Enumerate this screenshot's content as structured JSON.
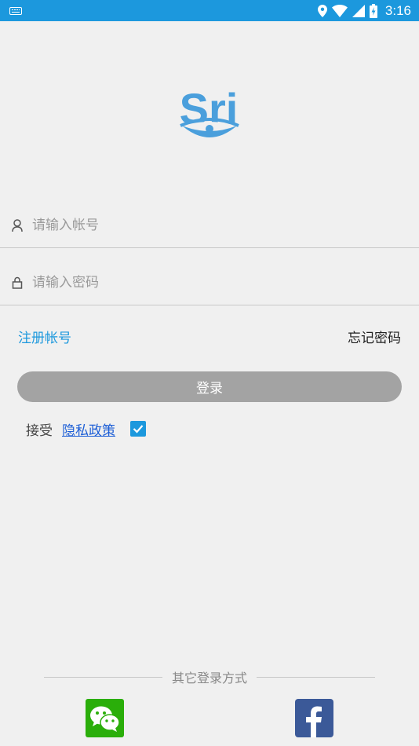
{
  "status_bar": {
    "time": "3:16"
  },
  "logo": {
    "text": "Sri",
    "color": "#4a9fdc"
  },
  "account": {
    "placeholder": "请输入帐号",
    "value": ""
  },
  "password": {
    "placeholder": "请输入密码",
    "value": ""
  },
  "links": {
    "register": "注册帐号",
    "forgot": "忘记密码"
  },
  "login": {
    "label": "登录"
  },
  "agreement": {
    "accept": "接受",
    "privacy": "隐私政策",
    "checked": true
  },
  "other_login": {
    "label": "其它登录方式"
  },
  "colors": {
    "accent": "#1c98dd",
    "wechat": "#2aae0a",
    "facebook": "#3b5998",
    "button_disabled": "#a3a3a3"
  }
}
